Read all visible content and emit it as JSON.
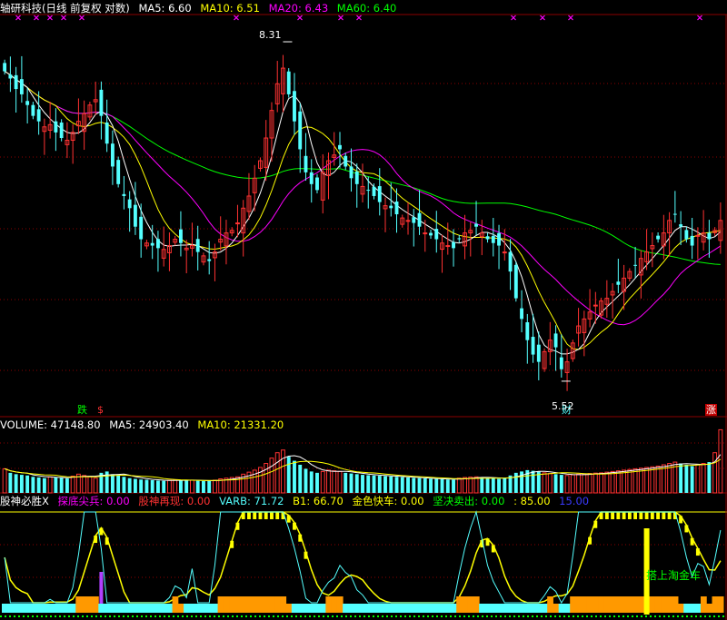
{
  "header": {
    "title": "轴研科技(日线 前复权 对数)",
    "ma5_label": "MA5: 6.60",
    "ma10_label": "MA10: 6.51",
    "ma20_label": "MA20: 6.43",
    "ma60_label": "MA60: 6.40"
  },
  "volume_header": {
    "volume_label": "VOLUME: 47148.80",
    "ma5_label": "MA5: 24903.40",
    "ma10_label": "MA10: 21331.20"
  },
  "indicator_header": {
    "name": "股神必胜X",
    "tandi_label": "探底尖兵: 0.00",
    "gushen_label": "股神再现: 0.00",
    "varb_label": "VARB: 71.72",
    "b1_label": "B1: 66.70",
    "jinse_label": "金色快车: 0.00",
    "jianjue_label": "坚决卖出: 0.00",
    "level1_label": ": 85.00",
    "level2_label": "15.00"
  },
  "annotations": {
    "high_label": "8.31",
    "low_label": "5.52",
    "die_flag": "跌",
    "s_flag": "$",
    "cai_flag": "财",
    "zhang_flag": "涨",
    "golden_car_text": "搭上淘金车"
  },
  "colors": {
    "up": "#ff3232",
    "down": "#54ffff",
    "ma5": "#ffffff",
    "ma10": "#ffff00",
    "ma20": "#ff00ff",
    "ma60": "#00ff00",
    "volume_up": "#ff3232",
    "volume_down": "#54ffff",
    "indicator_yellow": "#ffff00",
    "indicator_orange": "#ff9900",
    "indicator_cyan": "#54ffff",
    "indicator_purple": "#b040ff",
    "grid": "#8b0000"
  },
  "chart_data": {
    "type": "candlestick",
    "title": "轴研科技(日线 前复权 对数)",
    "ylim": [
      5.4,
      8.55
    ],
    "series_high": 8.31,
    "series_low": 5.52,
    "last_values": {
      "MA5": 6.6,
      "MA10": 6.51,
      "MA20": 6.43,
      "MA60": 6.4
    },
    "volume": {
      "last": 47148.8,
      "ma5": 24903.4,
      "ma10": 21331.2
    },
    "indicator": {
      "VARB": 71.72,
      "B1": 66.7,
      "levels": [
        85.0,
        15.0
      ]
    },
    "closes": [
      8.02,
      7.95,
      7.85,
      7.8,
      7.7,
      7.6,
      7.55,
      7.5,
      7.52,
      7.45,
      7.4,
      7.38,
      7.45,
      7.55,
      7.62,
      7.7,
      7.75,
      7.6,
      7.35,
      7.15,
      7.0,
      6.9,
      6.8,
      6.65,
      6.55,
      6.52,
      6.5,
      6.48,
      6.47,
      6.5,
      6.55,
      6.52,
      6.48,
      6.5,
      6.45,
      6.42,
      6.38,
      6.45,
      6.55,
      6.6,
      6.62,
      6.68,
      6.8,
      6.9,
      7.05,
      7.2,
      7.4,
      7.65,
      7.9,
      8.05,
      7.8,
      7.55,
      7.3,
      7.1,
      7.0,
      6.95,
      7.1,
      7.2,
      7.25,
      7.3,
      7.15,
      7.05,
      7.0,
      6.98,
      6.95,
      6.9,
      6.85,
      6.82,
      6.8,
      6.75,
      6.72,
      6.7,
      6.68,
      6.65,
      6.6,
      6.58,
      6.55,
      6.52,
      6.5,
      6.48,
      6.55,
      6.6,
      6.62,
      6.65,
      6.6,
      6.55,
      6.52,
      6.5,
      6.45,
      6.3,
      6.1,
      5.95,
      5.8,
      5.7,
      5.65,
      5.72,
      5.8,
      5.75,
      5.6,
      5.65,
      5.78,
      5.9,
      5.95,
      6.0,
      6.05,
      6.08,
      6.1,
      6.15,
      6.2,
      6.25,
      6.3,
      6.35,
      6.4,
      6.45,
      6.5,
      6.55,
      6.6,
      6.7,
      6.75,
      6.65,
      6.55,
      6.5,
      6.58,
      6.6,
      6.55,
      6.62,
      6.7
    ],
    "volumes": [
      18000,
      15000,
      14000,
      13500,
      13000,
      12000,
      11500,
      11000,
      12000,
      11800,
      11200,
      10800,
      12500,
      14000,
      13000,
      12000,
      11000,
      15000,
      16000,
      14000,
      13000,
      12000,
      11000,
      10500,
      10000,
      9800,
      9500,
      9200,
      9000,
      9400,
      9800,
      9600,
      9300,
      9500,
      9100,
      8900,
      8800,
      9500,
      10500,
      11000,
      11500,
      12000,
      14000,
      15500,
      17000,
      19000,
      22000,
      26000,
      30000,
      32000,
      27000,
      24000,
      21000,
      18000,
      16000,
      15000,
      16000,
      17000,
      16500,
      16000,
      15000,
      14500,
      14000,
      13500,
      13200,
      13000,
      12800,
      12500,
      12300,
      12000,
      11800,
      11500,
      11200,
      11000,
      10800,
      10600,
      10400,
      10200,
      10000,
      9800,
      11000,
      11500,
      11800,
      12000,
      11500,
      11000,
      10800,
      10500,
      11000,
      13000,
      15000,
      16000,
      17000,
      16500,
      16000,
      15000,
      14500,
      14000,
      13500,
      13000,
      13500,
      14000,
      14200,
      14500,
      14800,
      15000,
      15500,
      16000,
      16500,
      17000,
      17500,
      18000,
      18500,
      19000,
      19500,
      20000,
      21000,
      22000,
      23000,
      22000,
      21000,
      20000,
      21000,
      22000,
      23000,
      30000,
      47148.8
    ]
  }
}
